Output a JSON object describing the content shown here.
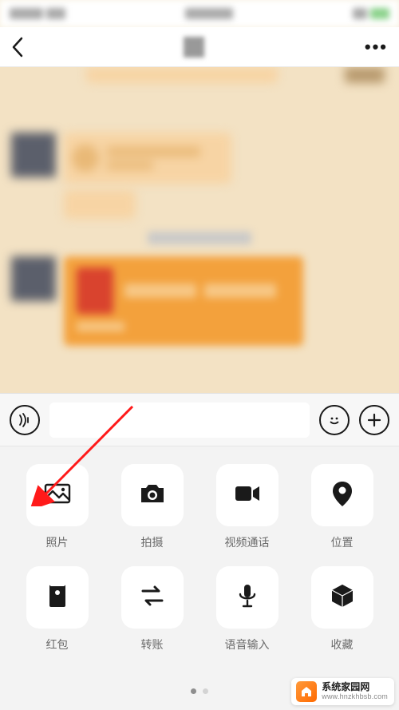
{
  "input": {
    "placeholder": ""
  },
  "attachments": {
    "items": [
      {
        "key": "photo",
        "label": "照片"
      },
      {
        "key": "camera",
        "label": "拍摄"
      },
      {
        "key": "videocall",
        "label": "视频通话"
      },
      {
        "key": "location",
        "label": "位置"
      },
      {
        "key": "redpacket",
        "label": "红包"
      },
      {
        "key": "transfer",
        "label": "转账"
      },
      {
        "key": "voice",
        "label": "语音输入"
      },
      {
        "key": "favorite",
        "label": "收藏"
      }
    ],
    "page_count": 2,
    "active_page": 0
  },
  "watermark": {
    "title": "系统家园网",
    "url": "www.hnzkhbsb.com"
  },
  "annotation": {
    "arrow_target": "photo"
  }
}
